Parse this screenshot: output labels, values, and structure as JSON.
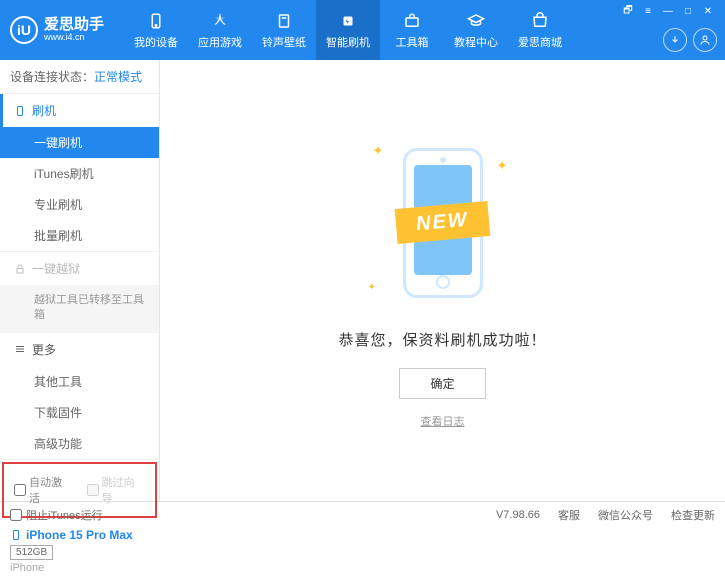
{
  "header": {
    "logo_text": "爱思助手",
    "logo_url": "www.i4.cn",
    "logo_initial": "iU"
  },
  "nav": [
    {
      "label": "我的设备"
    },
    {
      "label": "应用游戏"
    },
    {
      "label": "铃声壁纸"
    },
    {
      "label": "智能刷机"
    },
    {
      "label": "工具箱"
    },
    {
      "label": "教程中心"
    },
    {
      "label": "爱思商城"
    }
  ],
  "status": {
    "label": "设备连接状态：",
    "value": "正常模式"
  },
  "sidebar": {
    "flash_header": "刷机",
    "flash_items": [
      "一键刷机",
      "iTunes刷机",
      "专业刷机",
      "批量刷机"
    ],
    "jailbreak_header": "一键越狱",
    "jailbreak_note": "越狱工具已转移至工具箱",
    "more_header": "更多",
    "more_items": [
      "其他工具",
      "下载固件",
      "高级功能"
    ]
  },
  "checkboxes": {
    "auto_activate": "自动激活",
    "skip_guide": "跳过向导"
  },
  "device": {
    "name": "iPhone 15 Pro Max",
    "storage": "512GB",
    "type": "iPhone"
  },
  "main": {
    "new_badge": "NEW",
    "success_message": "恭喜您，保资料刷机成功啦！",
    "ok_button": "确定",
    "log_link": "查看日志"
  },
  "footer": {
    "block_itunes": "阻止iTunes运行",
    "version": "V7.98.66",
    "service": "客服",
    "wechat": "微信公众号",
    "update": "检查更新"
  }
}
